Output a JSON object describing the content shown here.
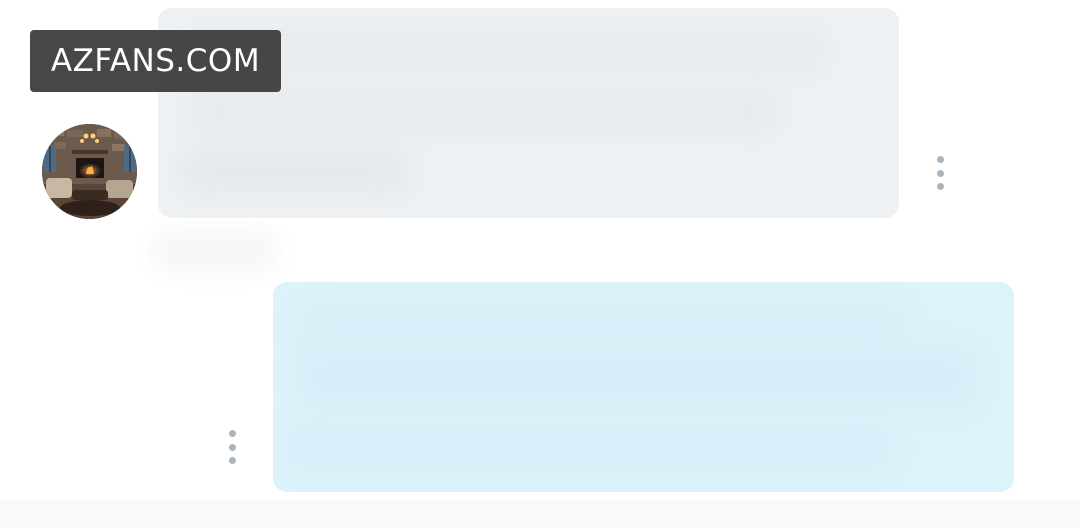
{
  "watermark": {
    "text": "AZFANS.COM"
  },
  "conversation": {
    "incoming_message": {
      "menu_icon": "more-vertical-icon",
      "background": "#eef1f3"
    },
    "outgoing_message": {
      "menu_icon": "more-vertical-icon",
      "background": "#ddf3fb"
    },
    "avatar": {
      "icon": "profile-photo-fireplace"
    }
  },
  "colors": {
    "page_background": "#ffffff",
    "kebab_dots": "#a9b4bd",
    "watermark_bg": "#373737"
  }
}
